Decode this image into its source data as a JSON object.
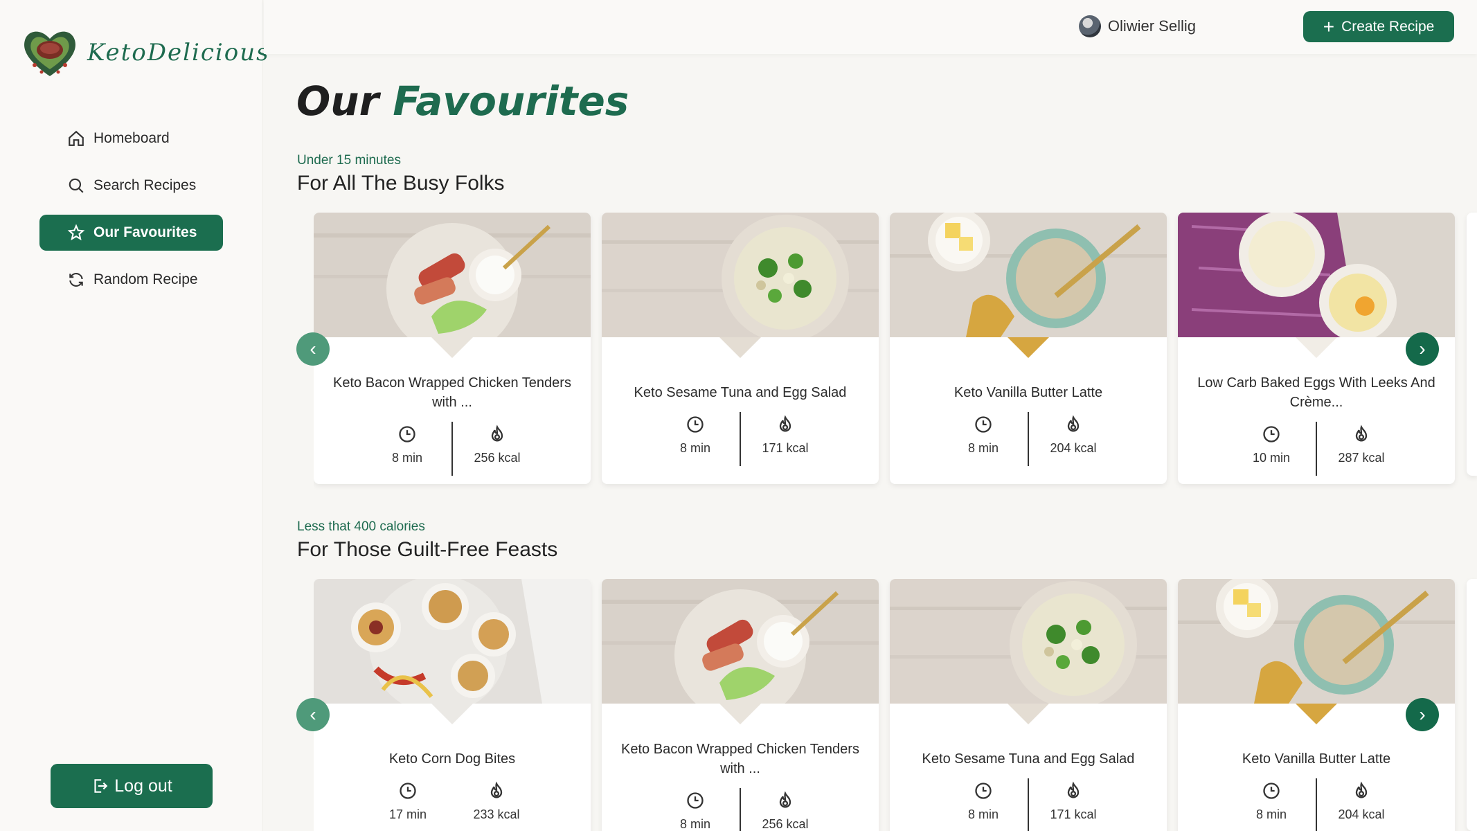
{
  "brand": {
    "name": "KetoDelicious"
  },
  "nav": {
    "items": [
      {
        "label": "Homeboard",
        "icon": "home-icon"
      },
      {
        "label": "Search Recipes",
        "icon": "search-icon"
      },
      {
        "label": "Our Favourites",
        "icon": "star-icon",
        "active": true
      },
      {
        "label": "Random Recipe",
        "icon": "refresh-icon"
      }
    ],
    "logout_label": "Log out"
  },
  "header": {
    "user_name": "Oliwier Sellig",
    "create_label": "Create Recipe"
  },
  "page": {
    "title_part1": "Our",
    "title_part2": "Favourites"
  },
  "sections": [
    {
      "subtitle": "Under 15 minutes",
      "title": "For All The Busy Folks",
      "cards": [
        {
          "title": "Keto Bacon Wrapped Chicken Tenders with ...",
          "time": "8 min",
          "kcal": "256 kcal"
        },
        {
          "title": "Keto Sesame Tuna and Egg Salad",
          "time": "8 min",
          "kcal": "171 kcal"
        },
        {
          "title": "Keto Vanilla Butter Latte",
          "time": "8 min",
          "kcal": "204 kcal"
        },
        {
          "title": "Low Carb Baked Eggs With Leeks And Crème...",
          "time": "10 min",
          "kcal": "287 kcal"
        }
      ]
    },
    {
      "subtitle": "Less that 400 calories",
      "title": "For Those Guilt-Free Feasts",
      "cards": [
        {
          "title": "Keto Corn Dog Bites",
          "time": "17 min",
          "kcal": "233 kcal"
        },
        {
          "title": "Keto Bacon Wrapped Chicken Tenders with ...",
          "time": "8 min",
          "kcal": "256 kcal"
        },
        {
          "title": "Keto Sesame Tuna and Egg Salad",
          "time": "8 min",
          "kcal": "171 kcal"
        },
        {
          "title": "Keto Vanilla Butter Latte",
          "time": "8 min",
          "kcal": "204 kcal"
        }
      ]
    }
  ],
  "colors": {
    "accent": "#1b6e4f",
    "accent_light": "#4f9a7a",
    "background": "#f7f6f3"
  }
}
